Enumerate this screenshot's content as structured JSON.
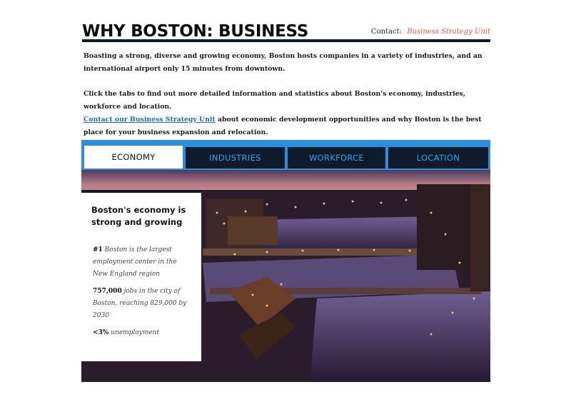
{
  "header": {
    "title": "WHY BOSTON: BUSINESS",
    "contact_label": "Contact:",
    "contact_link": "Business Strategy Unit"
  },
  "intro": {
    "paragraph1": "Boasting a strong, diverse and growing economy, Boston hosts companies in a variety of industries, and an international airport only 15 minutes from downtown.",
    "paragraph2_text": "Click the tabs to find out more detailed information and statistics about Boston's economy, industries, workforce and location.",
    "paragraph2_link": "Contact our Business Strategy Unit",
    "paragraph2_tail": " about economic development opportunities and why Boston is the best place for your business expansion and relocation."
  },
  "tabs": [
    {
      "label": "ECONOMY",
      "active": true
    },
    {
      "label": "INDUSTRIES",
      "active": false
    },
    {
      "label": "WORKFORCE",
      "active": false
    },
    {
      "label": "LOCATION",
      "active": false
    }
  ],
  "panel": {
    "title": "Boston's economy is strong and growing",
    "facts": [
      {
        "num": "#1",
        "text": " Boston is the largest employment center in the New England region"
      },
      {
        "num": "757,000",
        "text": " jobs in the city of Boston, reaching 829,000 by 2030"
      },
      {
        "num": "<3%",
        "text": " unemployment"
      }
    ]
  },
  "colors": {
    "accent_blue": "#2a8fde",
    "navy": "#0d1b2a",
    "link_red": "#e05a4a",
    "link_blue": "#1a6fd1"
  },
  "icons": {
    "hero_image": "boston-harbor-night-photo"
  }
}
